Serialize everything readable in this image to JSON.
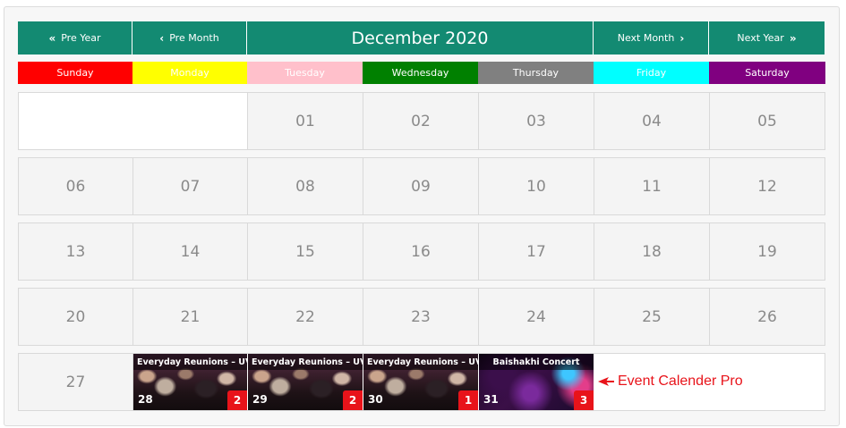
{
  "header": {
    "pre_year": "Pre Year",
    "pre_month": "Pre Month",
    "title": "December 2020",
    "next_month": "Next Month",
    "next_year": "Next Year",
    "color": "#138a72"
  },
  "weekdays": [
    {
      "label": "Sunday",
      "color": "#ff0000"
    },
    {
      "label": "Monday",
      "color": "#ffff00"
    },
    {
      "label": "Tuesday",
      "color": "#ffc0cb"
    },
    {
      "label": "Wednesday",
      "color": "#008000"
    },
    {
      "label": "Thursday",
      "color": "#808080"
    },
    {
      "label": "Friday",
      "color": "#00ffff"
    },
    {
      "label": "Saturday",
      "color": "#800080"
    }
  ],
  "weeks": [
    [
      "",
      "",
      "01",
      "02",
      "03",
      "04",
      "05"
    ],
    [
      "06",
      "07",
      "08",
      "09",
      "10",
      "11",
      "12"
    ],
    [
      "13",
      "14",
      "15",
      "16",
      "17",
      "18",
      "19"
    ],
    [
      "20",
      "21",
      "22",
      "23",
      "24",
      "25",
      "26"
    ],
    [
      "27"
    ]
  ],
  "events": [
    {
      "day": "28",
      "title": "Everyday Reunions – UVA",
      "count": "2",
      "image": "crowd"
    },
    {
      "day": "29",
      "title": "Everyday Reunions – UVA",
      "count": "2",
      "image": "crowd"
    },
    {
      "day": "30",
      "title": "Everyday Reunions – UVA",
      "count": "1",
      "image": "crowd"
    },
    {
      "day": "31",
      "title": "Baishakhi Concert",
      "count": "3",
      "image": "concert"
    }
  ],
  "annotation": {
    "text": "Event Calender Pro",
    "color": "#e8131a",
    "icon": "arrow-left-icon"
  }
}
